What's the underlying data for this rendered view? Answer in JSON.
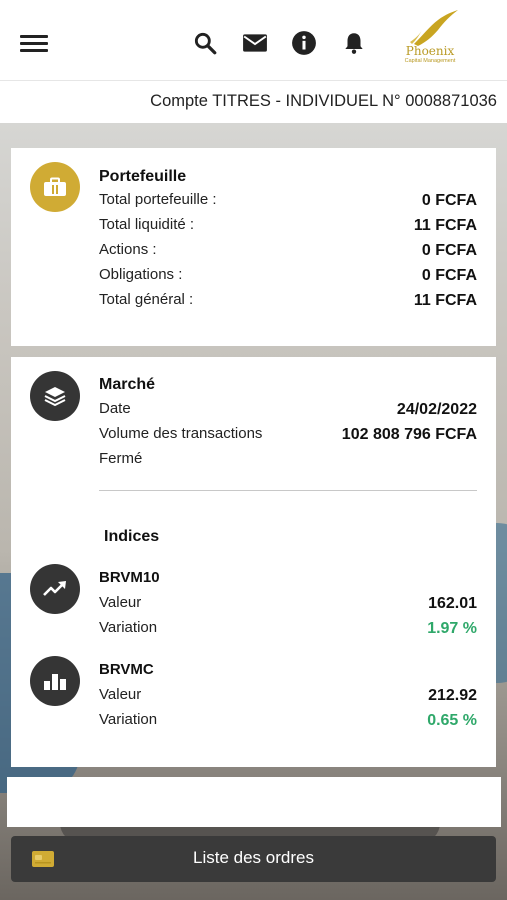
{
  "header": {
    "menu_icon": "hamburger-icon",
    "icons": [
      "search-icon",
      "mail-icon",
      "info-icon",
      "bell-icon"
    ],
    "logo_name": "Phoenix",
    "logo_subtitle": "Capital Management",
    "brand_color": "#d0ab34"
  },
  "account": {
    "label": "Compte TITRES - INDIVIDUEL N° 0008871036"
  },
  "portfolio": {
    "title": "Portefeuille",
    "icon": "briefcase-icon",
    "rows": [
      {
        "label": "Total portefeuille :",
        "value": "0 FCFA"
      },
      {
        "label": "Total liquidité :",
        "value": "11 FCFA"
      },
      {
        "label": "Actions :",
        "value": "0 FCFA"
      },
      {
        "label": "Obligations :",
        "value": "0 FCFA"
      },
      {
        "label": "Total général :",
        "value": "11 FCFA"
      }
    ]
  },
  "market": {
    "title": "Marché",
    "icon": "layers-icon",
    "date_label": "Date",
    "date_value": "24/02/2022",
    "volume_label": "Volume des transactions",
    "volume_value": "102 808 796 FCFA",
    "status": "Fermé",
    "indices_title": "Indices",
    "indices": [
      {
        "name": "BRVM10",
        "icon": "trending-up-icon",
        "value_label": "Valeur",
        "value": "162.01",
        "variation_label": "Variation",
        "variation": "1.97 %"
      },
      {
        "name": "BRVMC",
        "icon": "bar-chart-icon",
        "value_label": "Valeur",
        "value": "212.92",
        "variation_label": "Variation",
        "variation": "0.65 %"
      }
    ],
    "positive_color": "#2fa86a"
  },
  "orders_button": {
    "label": "Liste des ordres",
    "icon": "credit-card-icon"
  }
}
